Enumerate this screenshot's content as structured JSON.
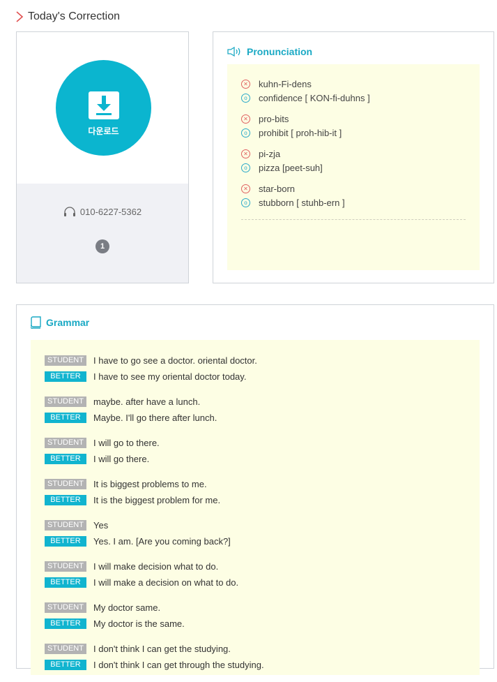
{
  "header": {
    "title": "Today's Correction"
  },
  "download": {
    "label": "다운로드"
  },
  "contact": {
    "phone": "010-6227-5362",
    "count": "1"
  },
  "pronunciation": {
    "title": "Pronunciation",
    "items": [
      {
        "wrong": "kuhn-Fi-dens",
        "right": "confidence [ KON-fi-duhns ]"
      },
      {
        "wrong": "pro-bits",
        "right": "prohibit [ proh-hib-it ]"
      },
      {
        "wrong": "pi-zja",
        "right": "pizza [peet-suh]"
      },
      {
        "wrong": "star-born",
        "right": "stubborn [ stuhb-ern ]"
      }
    ]
  },
  "grammar": {
    "title": "Grammar",
    "student_tag": "STUDENT",
    "better_tag": "BETTER",
    "items": [
      {
        "student": "I have to go see a doctor. oriental doctor.",
        "better": "I have to see my oriental doctor today."
      },
      {
        "student": "maybe. after have a lunch.",
        "better": "Maybe. I'll go there after lunch."
      },
      {
        "student": "I will go to there.",
        "better": "I will go there."
      },
      {
        "student": "It is biggest problems to me.",
        "better": "It is the biggest problem for me."
      },
      {
        "student": "Yes",
        "better": "Yes. I am. [Are you coming back?]"
      },
      {
        "student": "I will make decision what to do.",
        "better": "I will make a decision on what to do."
      },
      {
        "student": "My doctor same.",
        "better": "My doctor is the same."
      },
      {
        "student": "I don't think I can get the studying.",
        "better": "I don't think I can get through the studying."
      }
    ]
  },
  "colors": {
    "accent": "#0bb5cf",
    "wrong": "#e06060",
    "student_tag": "#b3b3b3"
  },
  "icons": [
    "chevron-right-icon",
    "download-icon",
    "headphones-icon",
    "speaker-icon",
    "book-icon",
    "x-circle-icon",
    "o-circle-icon"
  ]
}
